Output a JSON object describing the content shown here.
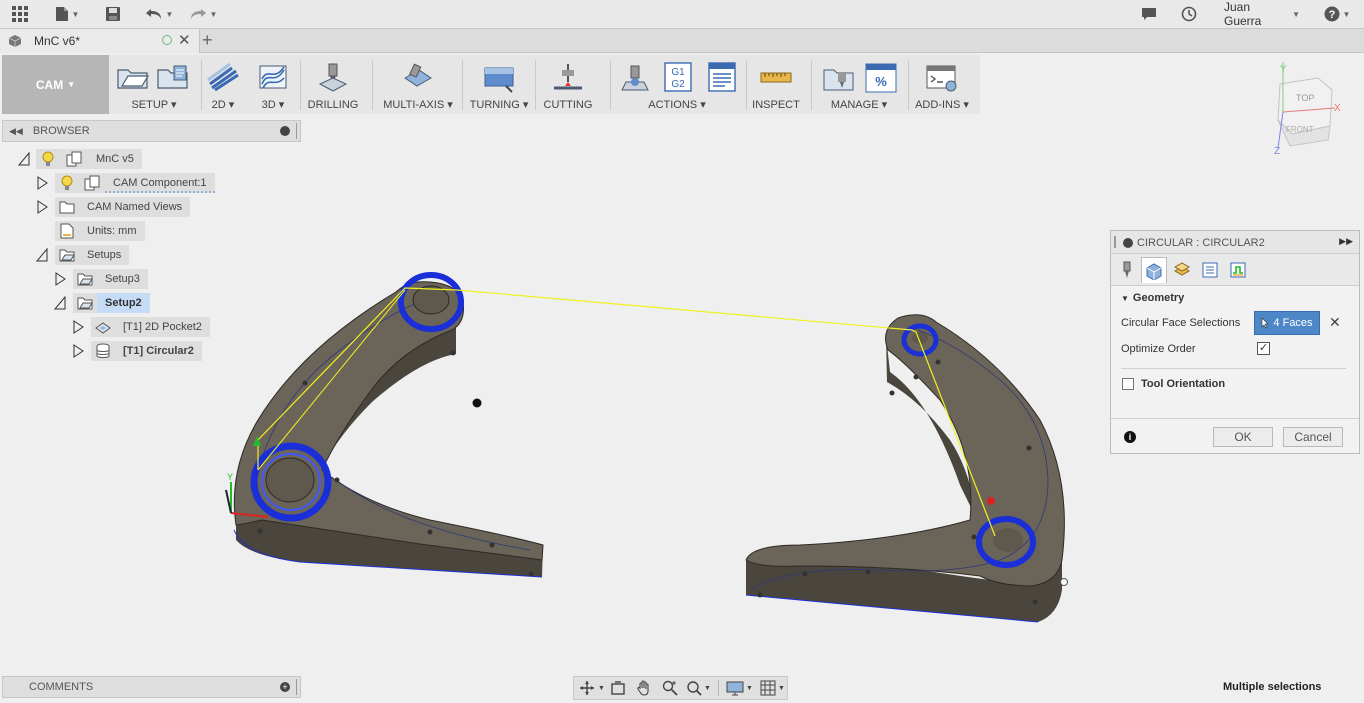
{
  "titlebar": {
    "user_name": "Juan Guerra"
  },
  "document_tab": {
    "title": "MnC v6*"
  },
  "toolbar": {
    "workspace": "CAM",
    "groups": [
      {
        "label": "SETUP",
        "dropdown": true
      },
      {
        "label": "2D",
        "dropdown": true
      },
      {
        "label": "3D",
        "dropdown": true
      },
      {
        "label": "DRILLING",
        "dropdown": false
      },
      {
        "label": "MULTI-AXIS",
        "dropdown": true
      },
      {
        "label": "TURNING",
        "dropdown": true
      },
      {
        "label": "CUTTING",
        "dropdown": false
      },
      {
        "label": "ACTIONS",
        "dropdown": true
      },
      {
        "label": "INSPECT",
        "dropdown": false
      },
      {
        "label": "MANAGE",
        "dropdown": true
      },
      {
        "label": "ADD-INS",
        "dropdown": true
      }
    ],
    "actions_g1g2_icon_text": [
      "G1",
      "G2"
    ]
  },
  "browser": {
    "title": "BROWSER",
    "tree": {
      "root": "MnC v5",
      "cam_component": "CAM Component:1",
      "named_views": "CAM Named Views",
      "units": "Units: mm",
      "setups": "Setups",
      "setup3": "Setup3",
      "setup2": "Setup2",
      "op1": "[T1] 2D Pocket2",
      "op2": "[T1] Circular2"
    }
  },
  "comments": {
    "title": "COMMENTS"
  },
  "viewcube": {
    "top": "TOP",
    "front": "FRONT",
    "axis_x": "X",
    "axis_y": "Y",
    "axis_z": "Z"
  },
  "panel": {
    "title": "CIRCULAR : CIRCULAR2",
    "section_geometry": "Geometry",
    "circular_face_label": "Circular Face Selections",
    "circular_face_value": "4 Faces",
    "optimize_label": "Optimize Order",
    "optimize_checked": true,
    "tool_orientation_label": "Tool Orientation",
    "tool_orientation_checked": false,
    "ok": "OK",
    "cancel": "Cancel"
  },
  "status": {
    "text": "Multiple selections"
  },
  "colors": {
    "accent": "#4d87c7",
    "selection": "#c6dbf5",
    "part": "#6b6458",
    "toolpath": "#1a2fd8",
    "rapid": "#f0f020"
  }
}
